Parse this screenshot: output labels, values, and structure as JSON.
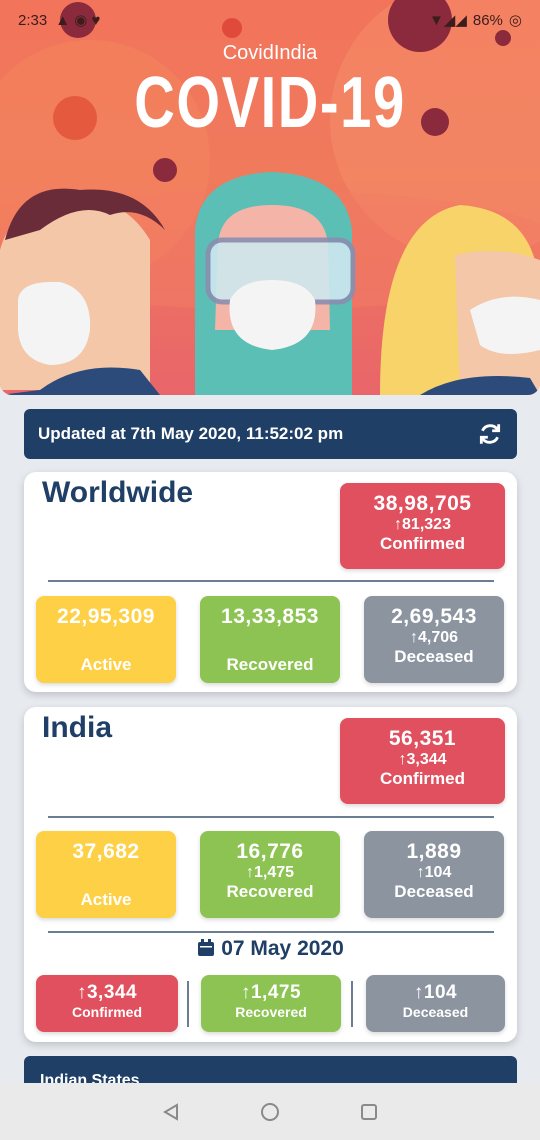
{
  "status_bar": {
    "time": "2:33",
    "battery": "86%"
  },
  "hero": {
    "app_name": "CovidIndia",
    "title": "COVID-19"
  },
  "update": {
    "text": "Updated at  7th May 2020, 11:52:02 pm"
  },
  "worldwide": {
    "title": "Worldwide",
    "confirmed": {
      "value": "38,98,705",
      "delta": "81,323",
      "label": "Confirmed"
    },
    "active": {
      "value": "22,95,309",
      "label": "Active"
    },
    "recovered": {
      "value": "13,33,853",
      "label": "Recovered"
    },
    "deceased": {
      "value": "2,69,543",
      "delta": "4,706",
      "label": "Deceased"
    }
  },
  "india": {
    "title": "India",
    "confirmed": {
      "value": "56,351",
      "delta": "3,344",
      "label": "Confirmed"
    },
    "active": {
      "value": "37,682",
      "label": "Active"
    },
    "recovered": {
      "value": "16,776",
      "delta": "1,475",
      "label": "Recovered"
    },
    "deceased": {
      "value": "1,889",
      "delta": "104",
      "label": "Deceased"
    },
    "daily": {
      "date": "07 May 2020",
      "confirmed": {
        "delta": "3,344",
        "label": "Confirmed"
      },
      "recovered": {
        "delta": "1,475",
        "label": "Recovered"
      },
      "deceased": {
        "delta": "104",
        "label": "Deceased"
      }
    }
  },
  "states_section": {
    "title": "Indian States"
  },
  "colors": {
    "navy": "#1f3f66",
    "confirmed": "#e0505e",
    "active": "#fdd046",
    "recovered": "#8dc353",
    "deceased": "#8c959f"
  }
}
